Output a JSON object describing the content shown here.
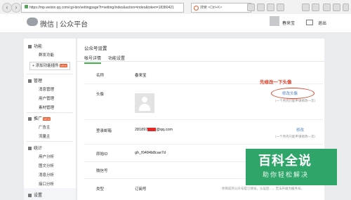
{
  "browser": {
    "url": "https://mp.weixin.qq.com/cgi-bin/settingpage?t=setting/index&action=index&token=18380421",
    "search_text": "搜索 <Ctrl+K>"
  },
  "header": {
    "logo_text": "微信 | 公众平台",
    "username": "春来宝",
    "logout": "退出"
  },
  "sidebar": {
    "sections": [
      {
        "title": "功能",
        "items": [
          "群发功能"
        ],
        "add_plugin": "+ 添加功能插件",
        "add_plugin_badge": "NEW"
      },
      {
        "title": "管理",
        "items": [
          "消息管理",
          "用户管理",
          "素材管理"
        ]
      },
      {
        "title": "推广",
        "title_badge": "NEW",
        "items": [
          "广告主",
          "流量主"
        ]
      },
      {
        "title": "统计",
        "items": [
          "用户分析",
          "图文分析",
          "消息分析",
          "接口分析"
        ]
      },
      {
        "title": "设置",
        "items": []
      }
    ]
  },
  "main": {
    "page_title": "公众号设置",
    "tabs": [
      "帐号详情",
      "功能设置"
    ],
    "active_tab": "帐号详情",
    "rows": {
      "name": {
        "label": "名称",
        "value": "春来宝"
      },
      "avatar": {
        "label": "头像",
        "link": "修改头像",
        "hint": "一个月内只能申请修改一次"
      },
      "email": {
        "label": "登录邮箱",
        "value_prefix": "281897",
        "value_suffix": "@qq.com",
        "link": "修改",
        "hint": "一个月内只能申请修改一次"
      },
      "origin_id": {
        "label": "原始ID",
        "value": "gh_f0484b8cae7d"
      },
      "wechat_id": {
        "label": "微信号"
      },
      "type": {
        "label": "类型",
        "value": "订阅号",
        "hint": "你目前的公众号是订阅号，认证后…，无法升级为服务号。"
      }
    },
    "annotation": "先修改一下头像"
  },
  "watermark": {
    "title": "百科全说",
    "subtitle": "助你轻松解决"
  }
}
